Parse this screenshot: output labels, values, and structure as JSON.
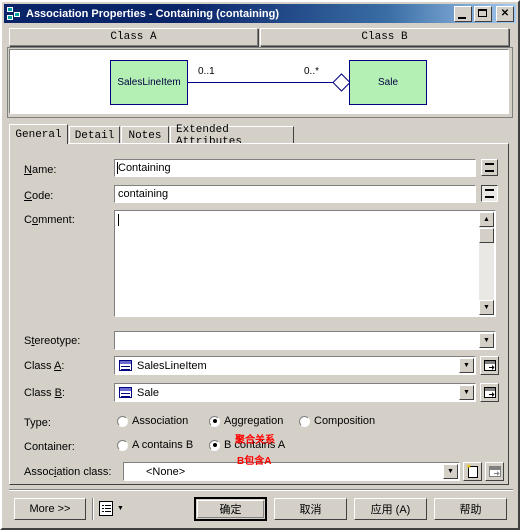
{
  "window": {
    "title": "Association Properties - Containing (containing)",
    "icon": "association-diagram-icon",
    "buttons": {
      "minimize": "_",
      "maximize": "□",
      "close": "✕"
    }
  },
  "preview": {
    "header_a": "Class A",
    "header_b": "Class B",
    "class_a_name": "SalesLineItem",
    "class_b_name": "Sale",
    "cardinality_a": "0..1",
    "cardinality_b": "0..*",
    "box_fill": "#b4f0b4",
    "box_border": "#000080",
    "link_kind": "aggregation-hollow-diamond"
  },
  "tabs": [
    {
      "label": "General",
      "active": true
    },
    {
      "label": "Detail",
      "active": false
    },
    {
      "label": "Notes",
      "active": false
    },
    {
      "label": "Extended Attributes",
      "active": false
    }
  ],
  "form": {
    "name_label": "Name:",
    "name_value": "Containing",
    "name_button": "=",
    "code_label": "Code:",
    "code_value": "containing",
    "code_button": "=",
    "comment_label": "Comment:",
    "comment_value": "",
    "stereotype_label": "Stereotype:",
    "stereotype_value": "",
    "class_a_label": "Class A:",
    "class_a_value": "SalesLineItem",
    "class_b_label": "Class B:",
    "class_b_value": "Sale",
    "type_label": "Type:",
    "type_options": [
      {
        "label": "Association",
        "selected": false
      },
      {
        "label": "Aggregation",
        "selected": true
      },
      {
        "label": "Composition",
        "selected": false
      }
    ],
    "container_label": "Container:",
    "container_options": [
      {
        "label": "A contains B",
        "selected": false
      },
      {
        "label": "B contains A",
        "selected": true
      }
    ],
    "association_class_label": "Association class:",
    "association_class_value": "<None>"
  },
  "annotations": [
    {
      "text": "聚合关系",
      "color": "#ff0000"
    },
    {
      "text": "B包含A",
      "color": "#ff0000"
    }
  ],
  "footer": {
    "more_label": "More >>",
    "report_icon": "list-report-icon",
    "ok_label": "确定",
    "cancel_label": "取消",
    "apply_label": "应用 (A)",
    "help_label": "帮助"
  }
}
